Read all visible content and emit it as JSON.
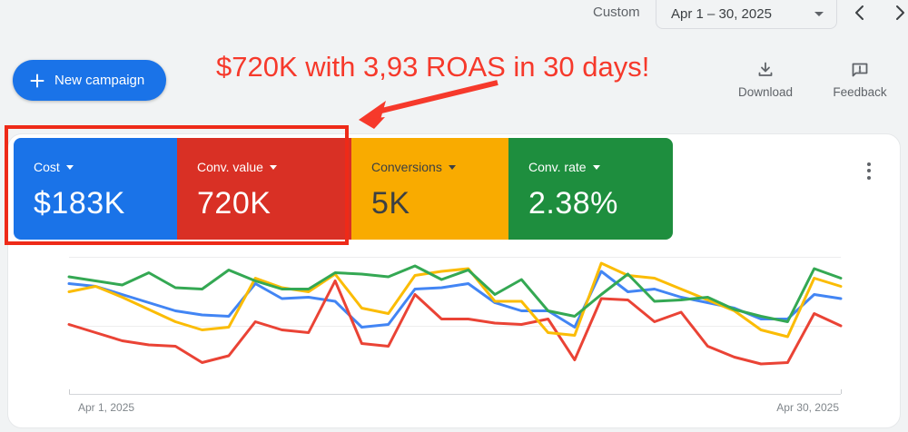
{
  "header": {
    "custom_label": "Custom",
    "date_range": "Apr 1 – 30, 2025",
    "new_campaign_label": "New campaign",
    "download_label": "Download",
    "feedback_label": "Feedback"
  },
  "annotation": {
    "text": "$720K with 3,93 ROAS in 30 days!",
    "color": "#f6392b"
  },
  "scorecards": [
    {
      "label": "Cost",
      "value": "$183K",
      "bg": "#1a73e8",
      "fg": "#ffffff"
    },
    {
      "label": "Conv. value",
      "value": "720K",
      "bg": "#d93025",
      "fg": "#ffffff"
    },
    {
      "label": "Conversions",
      "value": "5K",
      "bg": "#f9ab00",
      "fg": "#3c4043"
    },
    {
      "label": "Conv. rate",
      "value": "2.38%",
      "bg": "#1e8e3e",
      "fg": "#ffffff"
    }
  ],
  "chart_data": {
    "type": "line",
    "title": "",
    "xlabel": "",
    "ylabel": "",
    "x_axis": {
      "start_label": "Apr 1, 2025",
      "end_label": "Apr 30, 2025",
      "unit": "day",
      "days": 30
    },
    "y_axis": {
      "tick_labels_shown": false,
      "scale_note": "normalized 0-100, no y labels visible",
      "ylim": [
        0,
        100
      ]
    },
    "grid": "two faint horizontal gridlines plus bottom axis",
    "legend": "none (line colors match scorecard colors)",
    "series": [
      {
        "name": "Cost",
        "color": "#4285f4",
        "values": [
          81,
          79,
          73,
          67,
          61,
          58,
          57,
          81,
          70,
          71,
          68,
          49,
          51,
          77,
          78,
          81,
          67,
          61,
          61,
          49,
          90,
          75,
          77,
          71,
          67,
          63,
          55,
          55,
          73,
          70
        ]
      },
      {
        "name": "Conv. value",
        "color": "#ea4335",
        "values": [
          51,
          45,
          39,
          36,
          35,
          23,
          28,
          53,
          47,
          45,
          83,
          37,
          35,
          73,
          55,
          55,
          52,
          51,
          55,
          25,
          70,
          69,
          53,
          60,
          35,
          27,
          22,
          23,
          59,
          50
        ]
      },
      {
        "name": "Conversions",
        "color": "#fbbc04",
        "values": [
          75,
          79,
          71,
          62,
          53,
          47,
          49,
          85,
          78,
          75,
          88,
          63,
          59,
          87,
          90,
          92,
          68,
          68,
          45,
          43,
          96,
          87,
          85,
          77,
          69,
          61,
          47,
          42,
          85,
          79
        ]
      },
      {
        "name": "Conv. rate",
        "color": "#34a853",
        "values": [
          86,
          83,
          80,
          89,
          78,
          77,
          91,
          83,
          77,
          77,
          89,
          88,
          86,
          94,
          84,
          91,
          73,
          84,
          61,
          57,
          73,
          88,
          68,
          69,
          71,
          62,
          57,
          53,
          92,
          85
        ]
      }
    ]
  }
}
